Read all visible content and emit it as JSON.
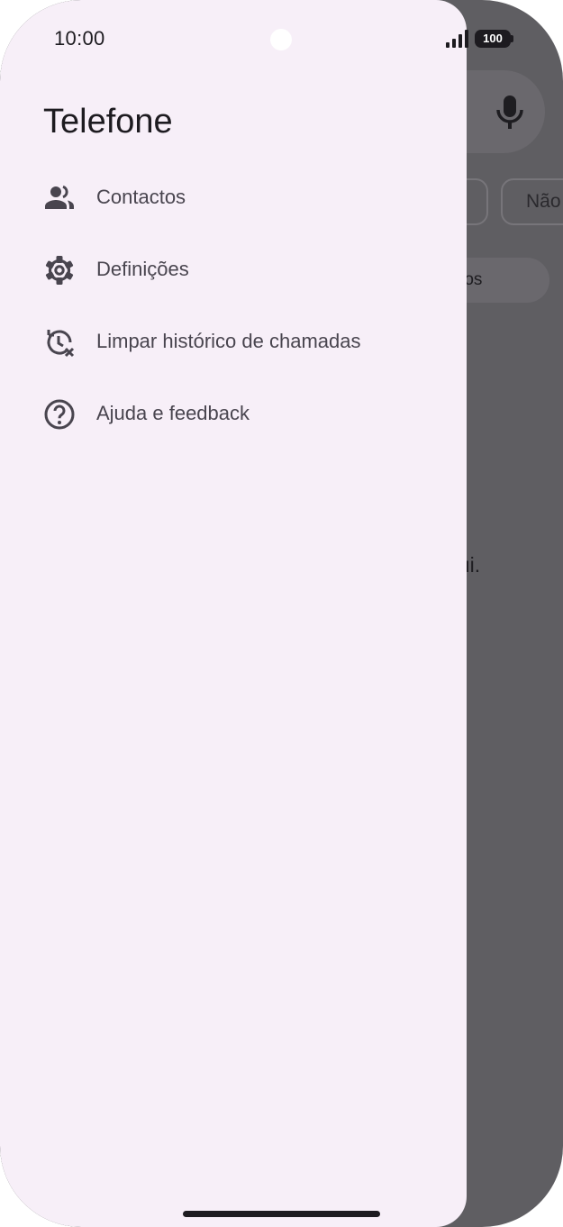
{
  "status_bar": {
    "time": "10:00",
    "battery": "100"
  },
  "drawer": {
    "title": "Telefone",
    "items": [
      {
        "label": "Contactos",
        "icon": "contacts-icon"
      },
      {
        "label": "Definições",
        "icon": "gear-icon"
      },
      {
        "label": "Limpar histórico de chamadas",
        "icon": "clear-history-icon"
      },
      {
        "label": "Ajuda e feedback",
        "icon": "help-icon"
      }
    ]
  },
  "background_app": {
    "chip_2_label": "Não",
    "pill_label": "actos",
    "hint_fragment": "qui."
  },
  "colors": {
    "drawer_background": "#f7eff8",
    "scrim": "#5f5e62",
    "text_primary": "#1d1b20",
    "text_secondary": "#49454f"
  }
}
